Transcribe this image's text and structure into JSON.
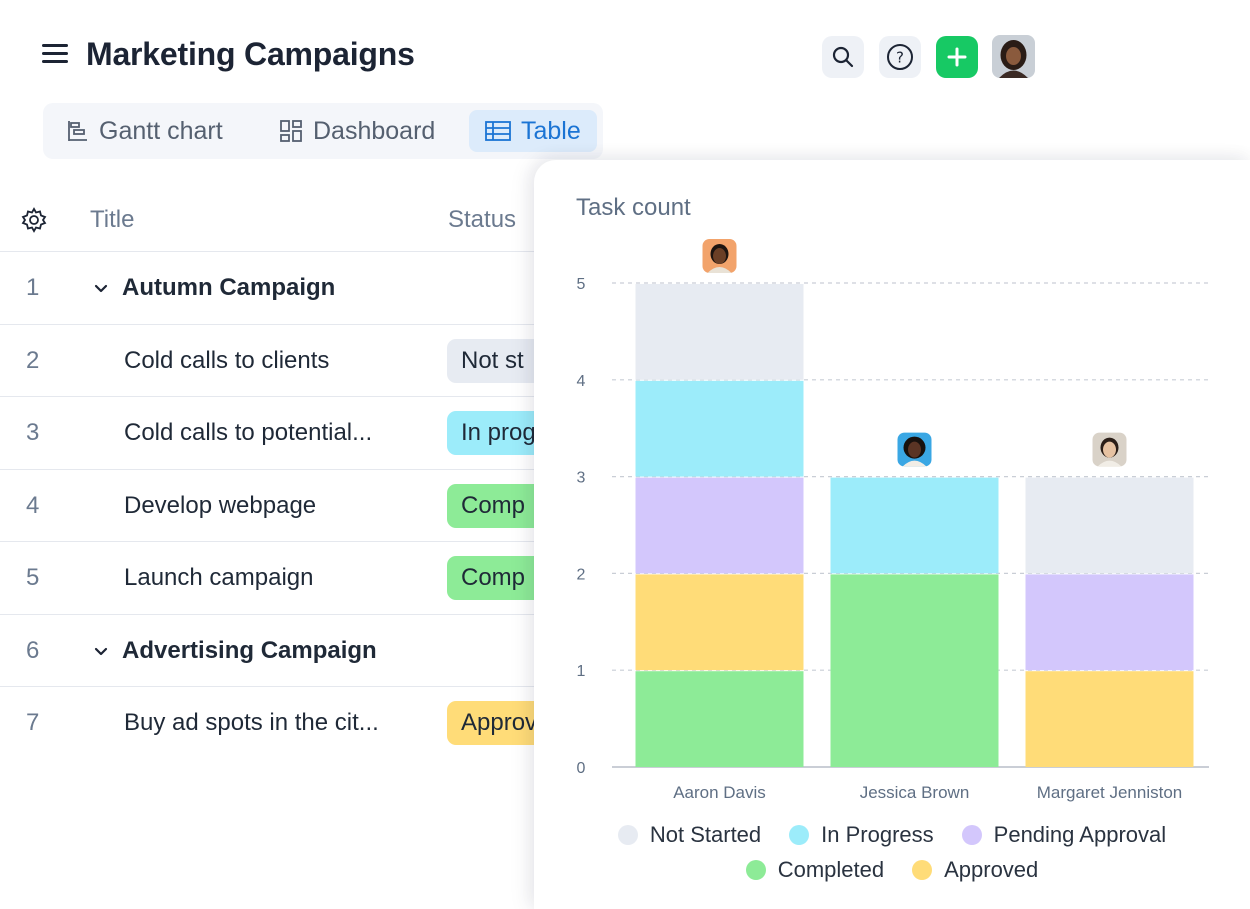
{
  "header": {
    "title": "Marketing Campaigns",
    "icons": {
      "menu": "hamburger-menu-icon",
      "search": "search-icon",
      "help": "help-icon",
      "add": "plus-icon"
    },
    "colors": {
      "add_button": "#17c964"
    }
  },
  "tabs": [
    {
      "label": "Gantt chart",
      "icon": "gantt-icon"
    },
    {
      "label": "Dashboard",
      "icon": "dashboard-icon"
    },
    {
      "label": "Table",
      "icon": "table-icon",
      "active": true
    }
  ],
  "table": {
    "columns": {
      "title": "Title",
      "status": "Status"
    },
    "rows": [
      {
        "num": "1",
        "title": "Autumn Campaign",
        "group": true
      },
      {
        "num": "2",
        "title": "Cold calls to clients",
        "status": "Not st"
      },
      {
        "num": "3",
        "title": "Cold calls to potential...",
        "status": "In prog"
      },
      {
        "num": "4",
        "title": "Develop webpage",
        "status": "Comp"
      },
      {
        "num": "5",
        "title": "Launch campaign",
        "status": "Comp"
      },
      {
        "num": "6",
        "title": "Advertising Campaign",
        "group": true
      },
      {
        "num": "7",
        "title": "Buy ad spots in the cit...",
        "status": "Approv"
      }
    ]
  },
  "chart": {
    "title": "Task count",
    "legend": {
      "not_started": "Not Started",
      "in_progress": "In Progress",
      "pending": "Pending Approval",
      "completed": "Completed",
      "approved": "Approved"
    }
  },
  "chart_data": {
    "type": "bar",
    "stacked": true,
    "title": "Task count",
    "categories": [
      "Aaron Davis",
      "Jessica Brown",
      "Margaret Jenniston"
    ],
    "ylim": [
      0,
      5
    ],
    "yticks": [
      "0",
      "1",
      "2",
      "3",
      "4",
      "5"
    ],
    "grid": true,
    "legend_position": "bottom",
    "series": [
      {
        "name": "Completed",
        "color": "#8deb97",
        "values": [
          1,
          2,
          0
        ]
      },
      {
        "name": "Approved",
        "color": "#ffdc78",
        "values": [
          1,
          0,
          1
        ]
      },
      {
        "name": "Pending Approval",
        "color": "#d3c7fc",
        "values": [
          1,
          0,
          1
        ]
      },
      {
        "name": "In Progress",
        "color": "#9cecfa",
        "values": [
          1,
          1,
          0
        ]
      },
      {
        "name": "Not Started",
        "color": "#e7ebf2",
        "values": [
          1,
          0,
          1
        ]
      }
    ]
  },
  "colors": {
    "not_started_bg": "#e7ebf2",
    "in_progress_bg": "#9cecfa",
    "completed_bg": "#8deb97",
    "approved_bg": "#ffdc78",
    "pending_bg": "#d3c7fc",
    "tab_active_bg": "#dcebfb",
    "tab_active_text": "#1b74d4"
  }
}
